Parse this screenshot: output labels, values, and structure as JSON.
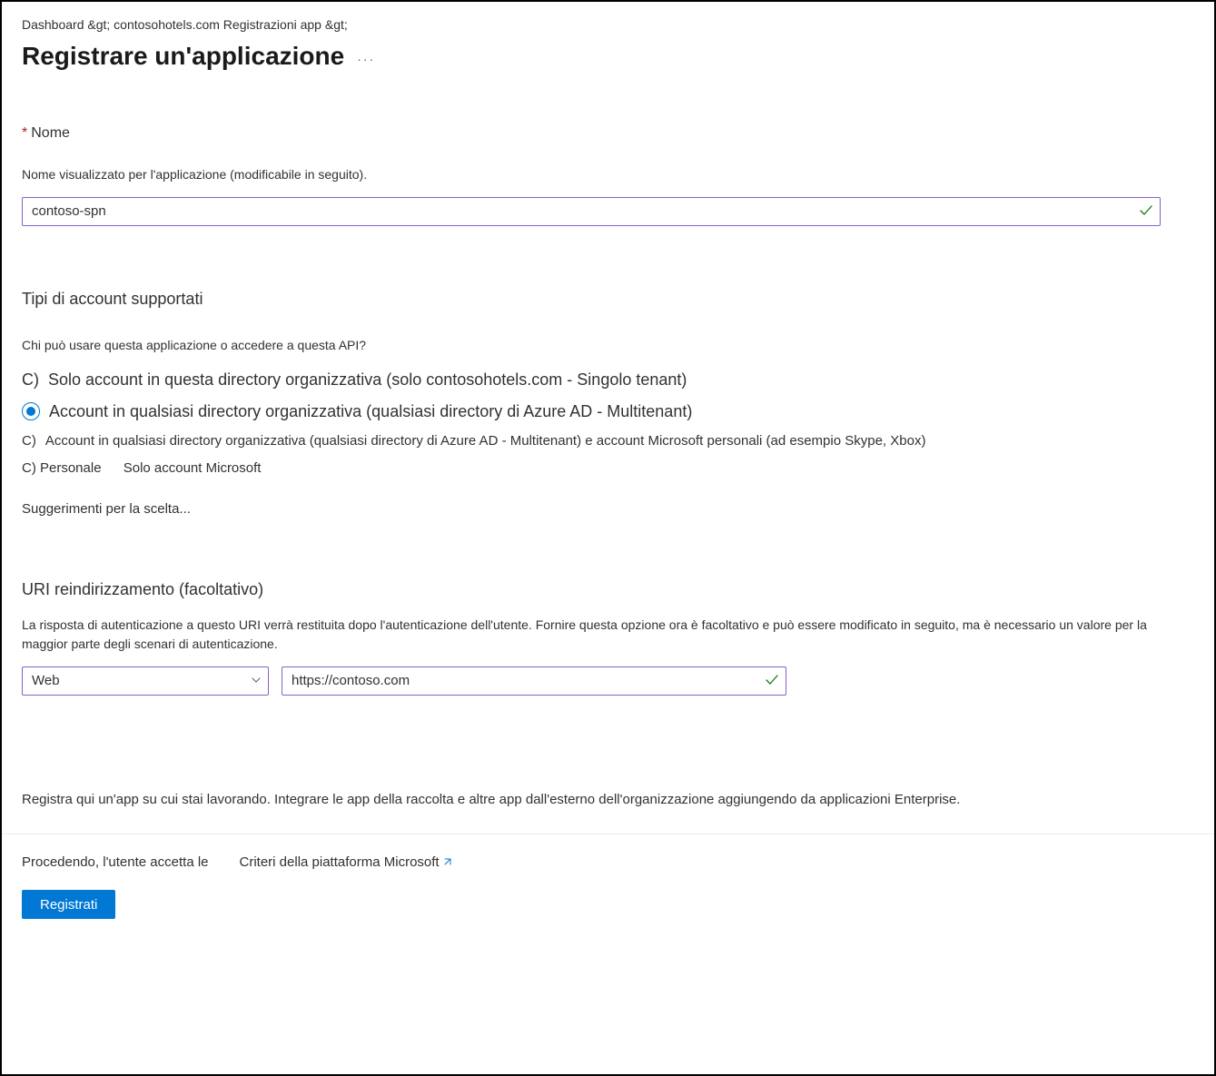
{
  "breadcrumb": "Dashboard &gt; contosohotels.com Registrazioni app &gt;",
  "page_title": "Registrare un'applicazione",
  "more_icon_alt": "Altri comandi",
  "name_section": {
    "label": "Nome",
    "helper": "Nome visualizzato per l'applicazione (modificabile in seguito).",
    "value": "contoso-spn"
  },
  "account_types": {
    "header": "Tipi di account supportati",
    "question": "Chi può usare questa applicazione o accedere a questa API?",
    "options": [
      {
        "prefix": "C)",
        "text": "Solo account in questa directory organizzativa (solo contosohotels.com - Singolo tenant)",
        "selected": false
      },
      {
        "prefix": "",
        "text": "Account in qualsiasi directory organizzativa (qualsiasi directory di Azure AD - Multitenant)",
        "selected": true
      },
      {
        "prefix": "C)",
        "text": "Account in qualsiasi directory organizzativa (qualsiasi directory di Azure AD - Multitenant) e account Microsoft personali (ad esempio Skype, Xbox)",
        "selected": false
      },
      {
        "prefix": "C) Personale",
        "text": "Solo account Microsoft",
        "selected": false
      }
    ],
    "help_link": "Suggerimenti per la scelta..."
  },
  "redirect_uri": {
    "header": "URI reindirizzamento (facoltativo)",
    "description": "La risposta di autenticazione a questo URI verrà restituita dopo l'autenticazione dell'utente. Fornire questa opzione ora è facoltativo e può essere modificato in seguito, ma è necessario un valore per la maggior parte degli scenari di autenticazione.",
    "platform_value": "Web",
    "uri_value": "https://contoso.com"
  },
  "bottom_note": "Registra qui un'app su cui stai lavorando. Integrare le app della raccolta e altre app dall'esterno dell'organizzazione aggiungendo da applicazioni Enterprise.",
  "consent": {
    "prefix": "Procedendo, l'utente accetta le",
    "policy_link": "Criteri della piattaforma Microsoft"
  },
  "register_button": "Registrati"
}
